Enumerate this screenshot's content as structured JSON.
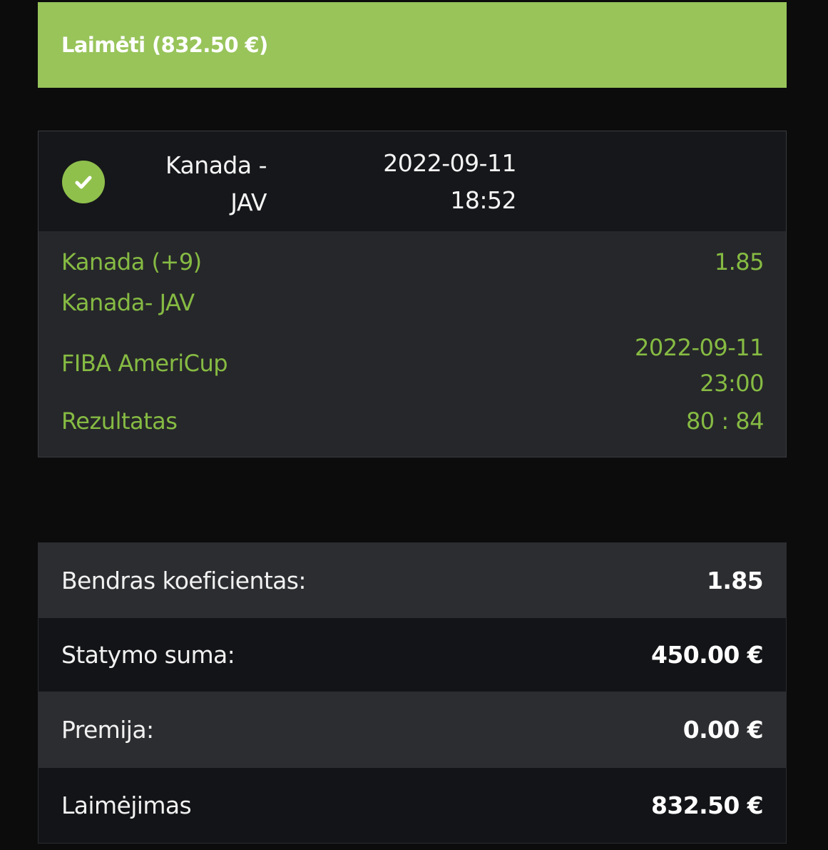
{
  "banner": {
    "label": "Laimėti (832.50 €)"
  },
  "event": {
    "teams_line1": "Kanada -",
    "teams_line2": "JAV",
    "date": "2022-09-11",
    "time": "18:52",
    "status_icon": "check-circle-icon",
    "selection": "Kanada (+9)",
    "odds": "1.85",
    "match": "Kanada- JAV",
    "league": "FIBA AmeriCup",
    "match_date": "2022-09-11",
    "match_time": "23:00",
    "result_label": "Rezultatas",
    "result_value": "80 : 84"
  },
  "summary": {
    "rows": [
      {
        "label": "Bendras koeficientas:",
        "value": "1.85"
      },
      {
        "label": "Statymo suma:",
        "value": "450.00 €"
      },
      {
        "label": "Premija:",
        "value": "0.00 €"
      },
      {
        "label": "Laimėjimas",
        "value": "832.50 €"
      }
    ]
  },
  "colors": {
    "accent_green": "#98c45a",
    "text_green": "#86bb43",
    "background": "#0c0c0d"
  }
}
